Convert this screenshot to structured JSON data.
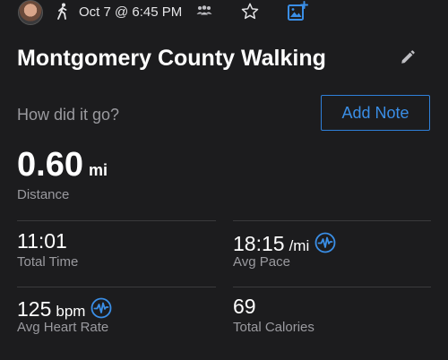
{
  "header": {
    "date_time": "Oct 7 @ 6:45 PM"
  },
  "activity": {
    "title": "Montgomery County Walking",
    "prompt": "How did it go?",
    "add_note_label": "Add Note"
  },
  "distance": {
    "value": "0.60",
    "unit": "mi",
    "label": "Distance"
  },
  "stats": {
    "total_time": {
      "value": "11:01",
      "label": "Total Time"
    },
    "avg_pace": {
      "value": "18:15",
      "unit": "/mi",
      "label": "Avg Pace"
    },
    "avg_heart_rate": {
      "value": "125",
      "unit": "bpm",
      "label": "Avg Heart Rate"
    },
    "total_calories": {
      "value": "69",
      "label": "Total Calories"
    }
  },
  "colors": {
    "background": "#1c1c1e",
    "accent": "#3a8ee6",
    "secondary_text": "#9a9a9f"
  },
  "icons": [
    "avatar",
    "walking-icon",
    "group-icon",
    "star-icon",
    "add-photo-icon",
    "edit-pencil-icon",
    "pulse-icon"
  ]
}
